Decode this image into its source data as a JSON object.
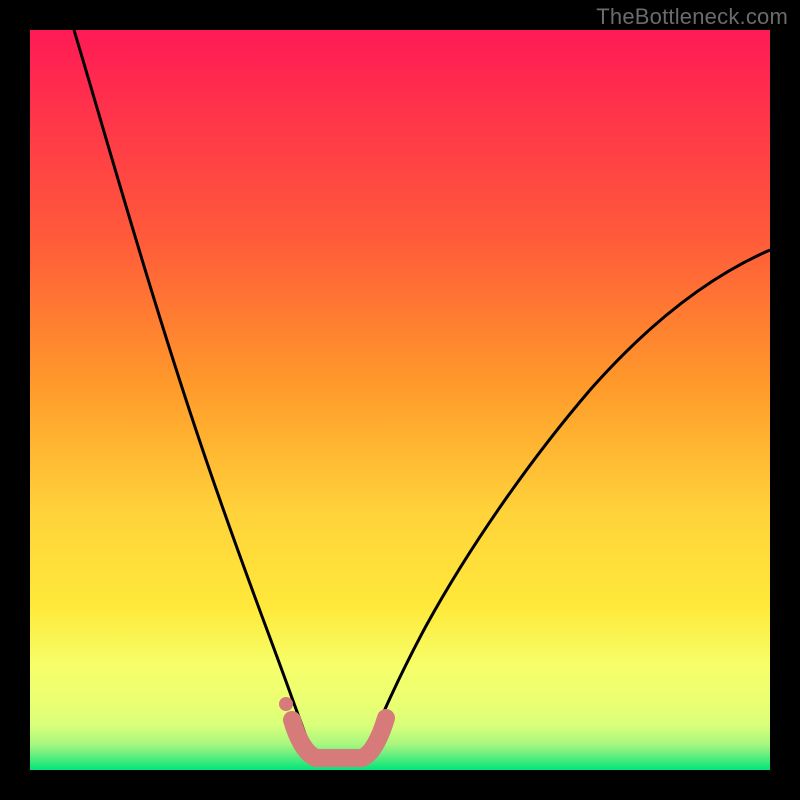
{
  "watermark": "TheBottleneck.com",
  "chart_data": {
    "type": "line",
    "title": "",
    "xlabel": "",
    "ylabel": "",
    "xlim": [
      0,
      100
    ],
    "ylim": [
      0,
      100
    ],
    "grid": false,
    "legend": false,
    "background_gradient": {
      "top": "#ff1a55",
      "mid_upper": "#ff8a2a",
      "mid": "#ffe93a",
      "mid_lower": "#f6ff6a",
      "lower": "#d8ff7a",
      "bottom": "#00e67a"
    },
    "series": [
      {
        "name": "left-curve",
        "color": "#000000",
        "x": [
          6,
          9,
          12,
          15,
          18,
          21,
          24,
          27,
          30,
          32,
          34,
          35.5,
          36.5,
          37.5
        ],
        "y": [
          100,
          88,
          76,
          64,
          53,
          43,
          33,
          25,
          17,
          12,
          8,
          5.5,
          4,
          3
        ]
      },
      {
        "name": "right-curve",
        "color": "#000000",
        "x": [
          45,
          47,
          49,
          52,
          55,
          59,
          63,
          68,
          73,
          78,
          84,
          90,
          96,
          100
        ],
        "y": [
          3,
          5,
          8,
          12,
          17,
          23,
          29,
          35,
          41,
          47,
          53,
          59,
          64,
          68
        ]
      },
      {
        "name": "bottom-salmon-band",
        "color": "#d67a7a",
        "x": [
          35,
          36,
          37,
          38,
          39,
          40,
          41,
          42,
          43,
          44,
          45,
          46
        ],
        "y": [
          6,
          4,
          2.5,
          2,
          2,
          2,
          2,
          2,
          2,
          2.5,
          4,
          6
        ]
      },
      {
        "name": "left-salmon-dot",
        "color": "#d67a7a",
        "type": "scatter",
        "x": [
          34.5
        ],
        "y": [
          8.5
        ]
      }
    ]
  }
}
